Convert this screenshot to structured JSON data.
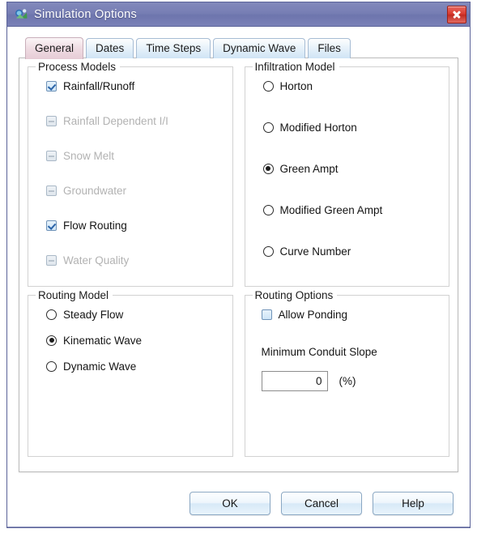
{
  "window": {
    "title": "Simulation Options",
    "app_icon": "swmm-droplet-icon",
    "close_icon": "close-icon",
    "titlebar_color": "#777eb4",
    "border_color": "#5b6399"
  },
  "tabs": [
    {
      "label": "General",
      "selected": true
    },
    {
      "label": "Dates",
      "selected": false
    },
    {
      "label": "Time Steps",
      "selected": false
    },
    {
      "label": "Dynamic Wave",
      "selected": false
    },
    {
      "label": "Files",
      "selected": false
    }
  ],
  "process_models": {
    "title": "Process Models",
    "items": [
      {
        "label": "Rainfall/Runoff",
        "checked": true,
        "enabled": true
      },
      {
        "label": "Rainfall Dependent I/I",
        "checked": false,
        "enabled": false
      },
      {
        "label": "Snow Melt",
        "checked": false,
        "enabled": false
      },
      {
        "label": "Groundwater",
        "checked": false,
        "enabled": false
      },
      {
        "label": "Flow Routing",
        "checked": true,
        "enabled": true
      },
      {
        "label": "Water Quality",
        "checked": false,
        "enabled": false
      }
    ]
  },
  "infiltration_model": {
    "title": "Infiltration Model",
    "selected": "Green Ampt",
    "options": [
      {
        "label": "Horton",
        "selected": false
      },
      {
        "label": "Modified Horton",
        "selected": false
      },
      {
        "label": "Green Ampt",
        "selected": true
      },
      {
        "label": "Modified Green Ampt",
        "selected": false
      },
      {
        "label": "Curve Number",
        "selected": false
      }
    ]
  },
  "routing_model": {
    "title": "Routing Model",
    "selected": "Kinematic Wave",
    "options": [
      {
        "label": "Steady Flow",
        "selected": false
      },
      {
        "label": "Kinematic Wave",
        "selected": true
      },
      {
        "label": "Dynamic Wave",
        "selected": false
      }
    ]
  },
  "routing_options": {
    "title": "Routing Options",
    "allow_ponding": {
      "label": "Allow Ponding",
      "checked": false,
      "enabled": true
    },
    "min_conduit_slope": {
      "label": "Minimum Conduit Slope",
      "value": "0",
      "unit": "(%)"
    }
  },
  "footer": {
    "ok_label": "OK",
    "cancel_label": "Cancel",
    "help_label": "Help"
  }
}
